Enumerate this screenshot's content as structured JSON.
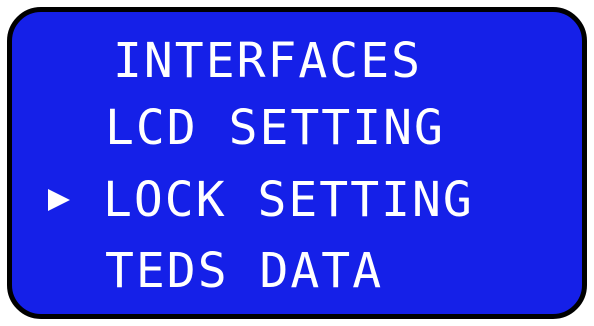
{
  "colors": {
    "screen_background": "#1520e8",
    "text": "#ffffff",
    "frame": "#000000"
  },
  "menu": {
    "items": [
      {
        "label": "INTERFACES",
        "selected": false
      },
      {
        "label": "LCD SETTING",
        "selected": false
      },
      {
        "label": "LOCK SETTING",
        "selected": true
      },
      {
        "label": "TEDS DATA",
        "selected": false
      }
    ],
    "pointer_icon": "right-triangle-pointer-icon"
  }
}
